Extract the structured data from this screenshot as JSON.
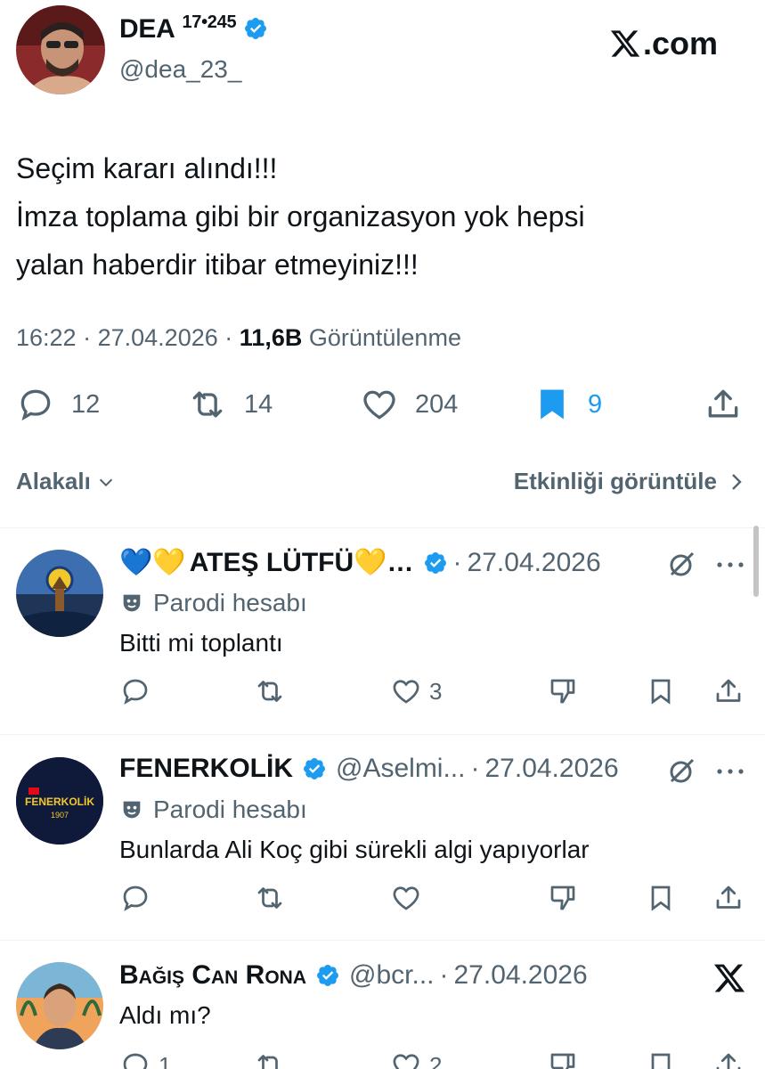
{
  "main_tweet": {
    "name": "DEA",
    "name_superscript": "17•245",
    "handle": "@dea_23_",
    "brand": "X.com",
    "text_lines": [
      "Seçim kararı alındı!!!",
      "İmza toplama gibi bir organizasyon yok hepsi",
      "yalan haberdir itibar etmeyiniz!!!"
    ],
    "time": "16:22",
    "sep": "·",
    "date": "27.04.2026",
    "views": "11,6B",
    "views_label": "Görüntülenme",
    "replies": "12",
    "reposts": "14",
    "likes": "204",
    "bookmarks": "9",
    "accent": "#1d9bf0"
  },
  "filter": {
    "related_label": "Alakalı",
    "activity_label": "Etkinliği görüntüle"
  },
  "replies": [
    {
      "name_emoji_left": "💙💛",
      "name": "ATEŞ LÜTFÜ",
      "name_emoji_right": "💛…",
      "handle": "",
      "date": "27.04.2026",
      "parody": "Parodi hesabı",
      "text": "Bitti mi toplantı",
      "likes": "3"
    },
    {
      "name": "FENERKOLİK",
      "handle": "@Aselmi...",
      "date": "27.04.2026",
      "parody": "Parodi hesabı",
      "avatar_text": "FENERKOLİK",
      "avatar_sub": "1907",
      "text": "Bunlarda Ali Koç gibi sürekli algi yapıyorlar"
    },
    {
      "name": "Bağış Can Rona",
      "handle": "@bcr...",
      "date": "27.04.2026",
      "text": "Aldı mı?",
      "replies": "1",
      "likes": "2"
    }
  ]
}
